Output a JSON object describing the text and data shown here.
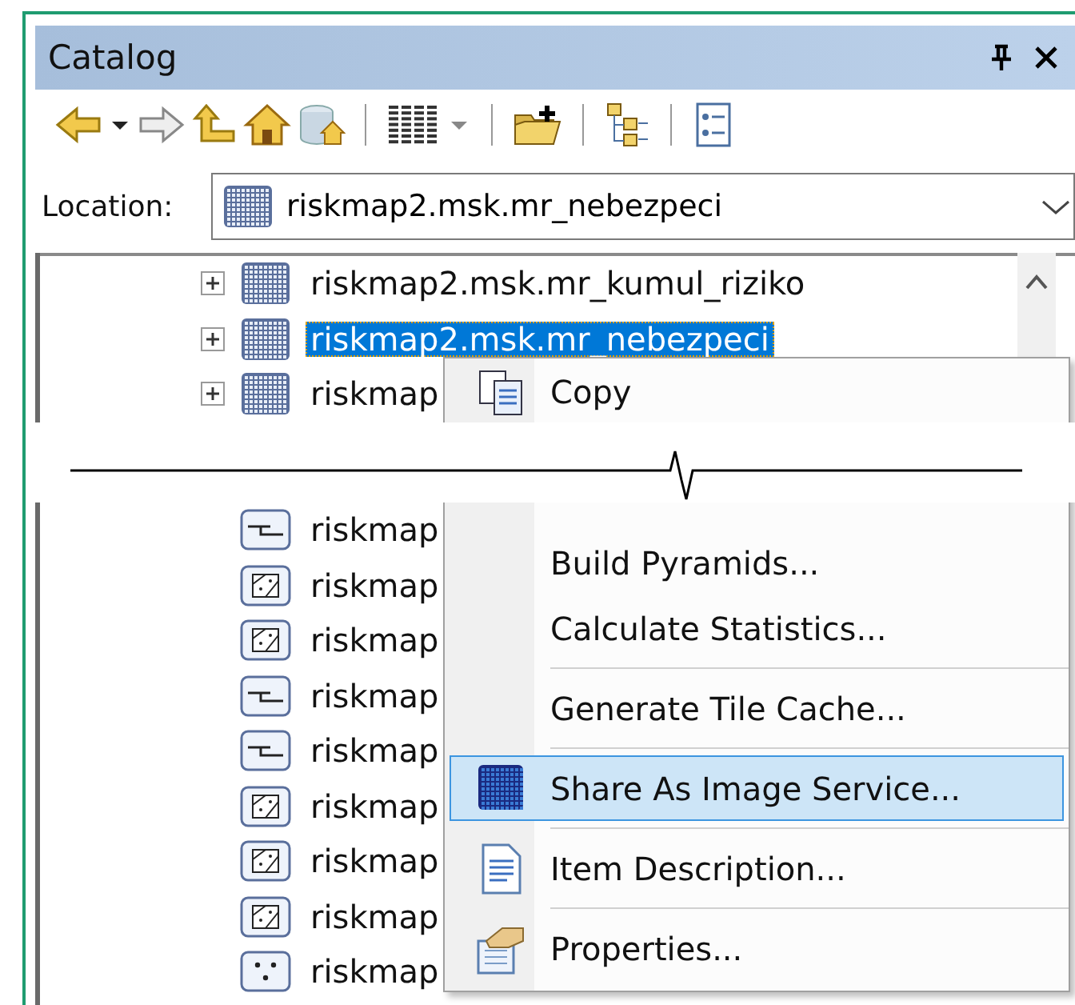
{
  "panel": {
    "title": "Catalog"
  },
  "toolbar": [
    {
      "kind": "back"
    },
    {
      "kind": "caret"
    },
    {
      "kind": "forward"
    },
    {
      "kind": "up"
    },
    {
      "kind": "home"
    },
    {
      "kind": "dbhome"
    },
    {
      "kind": "sep"
    },
    {
      "kind": "grid"
    },
    {
      "kind": "caret_gray"
    },
    {
      "kind": "sep"
    },
    {
      "kind": "addfolder"
    },
    {
      "kind": "sep"
    },
    {
      "kind": "tree"
    },
    {
      "kind": "sep"
    },
    {
      "kind": "details"
    }
  ],
  "location": {
    "label": "Location:",
    "value": "riskmap2.msk.mr_nebezpeci"
  },
  "tree": {
    "rows_top": [
      {
        "kind": "raster",
        "label": "riskmap2.msk.mr_kumul_riziko",
        "expandable": true,
        "selected": false
      },
      {
        "kind": "raster",
        "label": "riskmap2.msk.mr_nebezpeci",
        "expandable": true,
        "selected": true
      },
      {
        "kind": "raster",
        "label": "riskmap",
        "expandable": true,
        "selected": false
      }
    ],
    "rows_bottom": [
      {
        "kind": "line",
        "label": "riskmap",
        "expandable": false,
        "selected": false
      },
      {
        "kind": "polygon",
        "label": "riskmap",
        "expandable": false,
        "selected": false
      },
      {
        "kind": "polygon",
        "label": "riskmap",
        "expandable": false,
        "selected": false
      },
      {
        "kind": "line",
        "label": "riskmap",
        "expandable": false,
        "selected": false
      },
      {
        "kind": "line",
        "label": "riskmap",
        "expandable": false,
        "selected": false
      },
      {
        "kind": "polygon",
        "label": "riskmap",
        "expandable": false,
        "selected": false
      },
      {
        "kind": "polygon",
        "label": "riskmap",
        "expandable": false,
        "selected": false
      },
      {
        "kind": "polygon",
        "label": "riskmap",
        "expandable": false,
        "selected": false
      },
      {
        "kind": "point",
        "label": "riskmap",
        "expandable": false,
        "selected": false
      }
    ]
  },
  "menu": {
    "upper": [
      {
        "label": "Copy",
        "kind": "copy",
        "separator_before": false,
        "selected": false
      }
    ],
    "lower": [
      {
        "label": "Build Pyramids...",
        "kind": "plain",
        "separator_before": false,
        "selected": false
      },
      {
        "label": "Calculate Statistics...",
        "kind": "plain",
        "separator_before": false,
        "selected": false
      },
      {
        "label": "Generate Tile Cache...",
        "kind": "plain",
        "separator_before": true,
        "selected": false
      },
      {
        "label": "Share As Image Service...",
        "kind": "raster",
        "separator_before": true,
        "selected": true
      },
      {
        "label": "Item Description...",
        "kind": "document",
        "separator_before": true,
        "selected": false
      },
      {
        "label": "Properties...",
        "kind": "properties",
        "separator_before": true,
        "selected": false
      }
    ]
  }
}
